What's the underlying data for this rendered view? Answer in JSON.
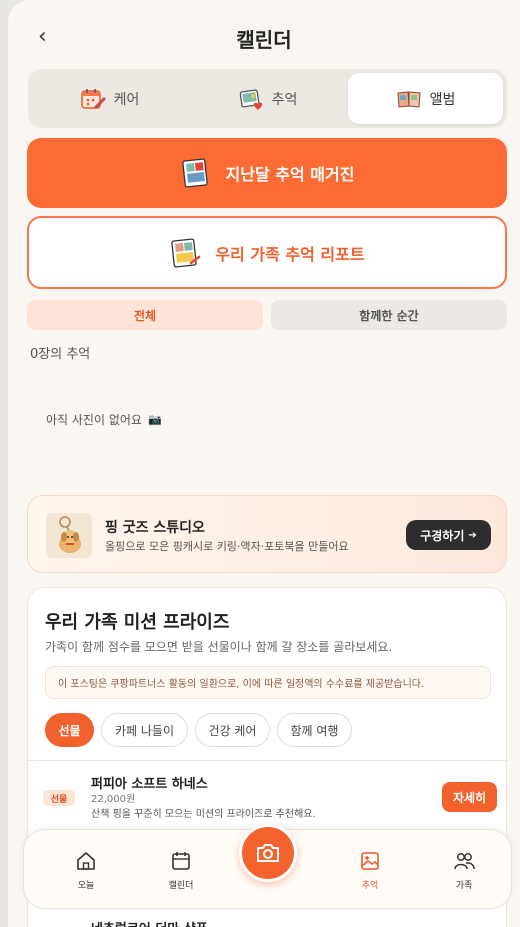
{
  "header": {
    "back_glyph": "‹",
    "title": "캘린더"
  },
  "tabs": [
    {
      "label": "케어",
      "icon": "calendar-care-icon"
    },
    {
      "label": "추억",
      "icon": "photo-memory-icon"
    },
    {
      "label": "앨범",
      "icon": "album-book-icon",
      "active": true
    }
  ],
  "actions": {
    "magazine_label": "지난달 추억 매거진",
    "report_label": "우리 가족 추억 리포트"
  },
  "filters": {
    "all": "전체",
    "together": "함께한 순간",
    "selected": "전체"
  },
  "album": {
    "count_text": "0장의 추억",
    "empty_text": "아직 사진이 없어요",
    "empty_icon": "📷"
  },
  "goods": {
    "title": "핑 굿즈 스튜디오",
    "desc": "올핑으로 모은 핑캐시로 키링·액자·포토북을 만들어요",
    "button": "구경하기",
    "button_arrow": "➔"
  },
  "mission": {
    "title": "우리 가족 미션 프라이즈",
    "subtitle": "가족이 함께 점수를 모으면 받을 선물이나 함께 갈 장소를 골라보세요.",
    "notice": "이 포스팅은 쿠팡파트너스 활동의 일환으로, 이에 따른 일정액의 수수료를 제공받습니다.",
    "chips": [
      "선물",
      "카페 나들이",
      "건강 케어",
      "함께 여행"
    ],
    "active_chip": "선물",
    "products": [
      {
        "badge": "선물",
        "name": "퍼피아 소프트 하네스",
        "price": "22,000원",
        "desc": "산책 핑을 꾸준히 모으는 미션의 프라이즈로 추천해요.",
        "button": "자세히"
      },
      {
        "name": "네츄럴코어 더마 샴푸"
      }
    ]
  },
  "bottom_nav": [
    {
      "label": "오늘",
      "icon": "home-icon"
    },
    {
      "label": "캘린더",
      "icon": "calendar-icon"
    },
    {
      "label": "",
      "icon": "camera-icon"
    },
    {
      "label": "추억",
      "icon": "image-icon",
      "active": true
    },
    {
      "label": "가족",
      "icon": "family-icon"
    }
  ],
  "colors": {
    "accent": "#f4632e",
    "background": "#faf7f2",
    "dark_button": "#2d2d2d"
  }
}
